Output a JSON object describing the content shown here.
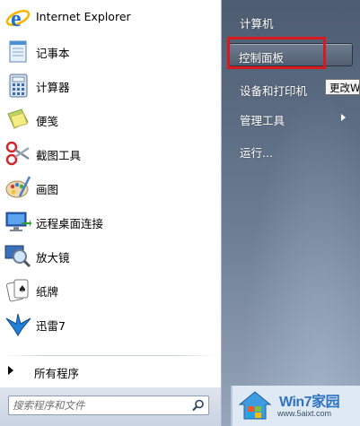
{
  "programs": [
    {
      "label": "Internet Explorer",
      "icon": "ie-icon"
    },
    {
      "label": "记事本",
      "icon": "notepad-icon"
    },
    {
      "label": "计算器",
      "icon": "calculator-icon"
    },
    {
      "label": "便笺",
      "icon": "sticky-notes-icon"
    },
    {
      "label": "截图工具",
      "icon": "snipping-tool-icon"
    },
    {
      "label": "画图",
      "icon": "paint-icon"
    },
    {
      "label": "远程桌面连接",
      "icon": "remote-desktop-icon"
    },
    {
      "label": "放大镜",
      "icon": "magnifier-icon"
    },
    {
      "label": "纸牌",
      "icon": "solitaire-icon"
    },
    {
      "label": "迅雷7",
      "icon": "thunder-icon"
    }
  ],
  "all_programs_label": "所有程序",
  "search": {
    "placeholder": "搜索程序和文件"
  },
  "right_menu": [
    {
      "label": "计算机"
    },
    {
      "label": "控制面板",
      "highlighted": true
    },
    {
      "label": "设备和打印机"
    },
    {
      "label": "管理工具",
      "has_submenu": true
    },
    {
      "label": "运行..."
    }
  ],
  "tooltip": "更改Windows设置",
  "watermark": {
    "title": "Win7家园",
    "url": "www.5aixt.com"
  },
  "colors": {
    "highlight_border": "#d8191e",
    "right_pane": "#5a6a80"
  }
}
